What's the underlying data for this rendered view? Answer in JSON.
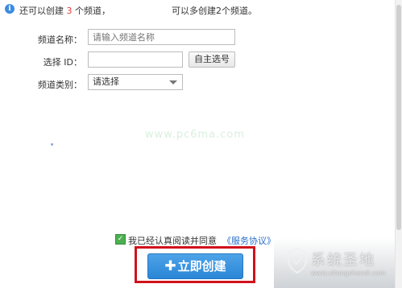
{
  "info": {
    "text_prefix": "还可以创建",
    "count": "3",
    "text_suffix": "个频道，",
    "right_text": "可以多创建2个频道。"
  },
  "form": {
    "name_label": "频道名称：",
    "name_placeholder": "请输入频道名称",
    "id_label": "选择 ID：",
    "id_value": "",
    "self_select_button": "自主选号",
    "category_label": "频道类别：",
    "category_value": "请选择"
  },
  "watermark_mid": "www.pc6ma.com",
  "agreement": {
    "checked": true,
    "text": "我已经认真阅读并同意",
    "link": "《服务协议》"
  },
  "create_button": {
    "icon": "plus-icon",
    "label": "立即创建"
  },
  "logo": {
    "title": "系统圣地",
    "url": "www.xitongshendi.com"
  },
  "colors": {
    "accent": "#2b86d6",
    "highlight": "#d0121b",
    "count": "#e4393c",
    "link": "#2a6fc9",
    "checkbox": "#4caf50"
  }
}
